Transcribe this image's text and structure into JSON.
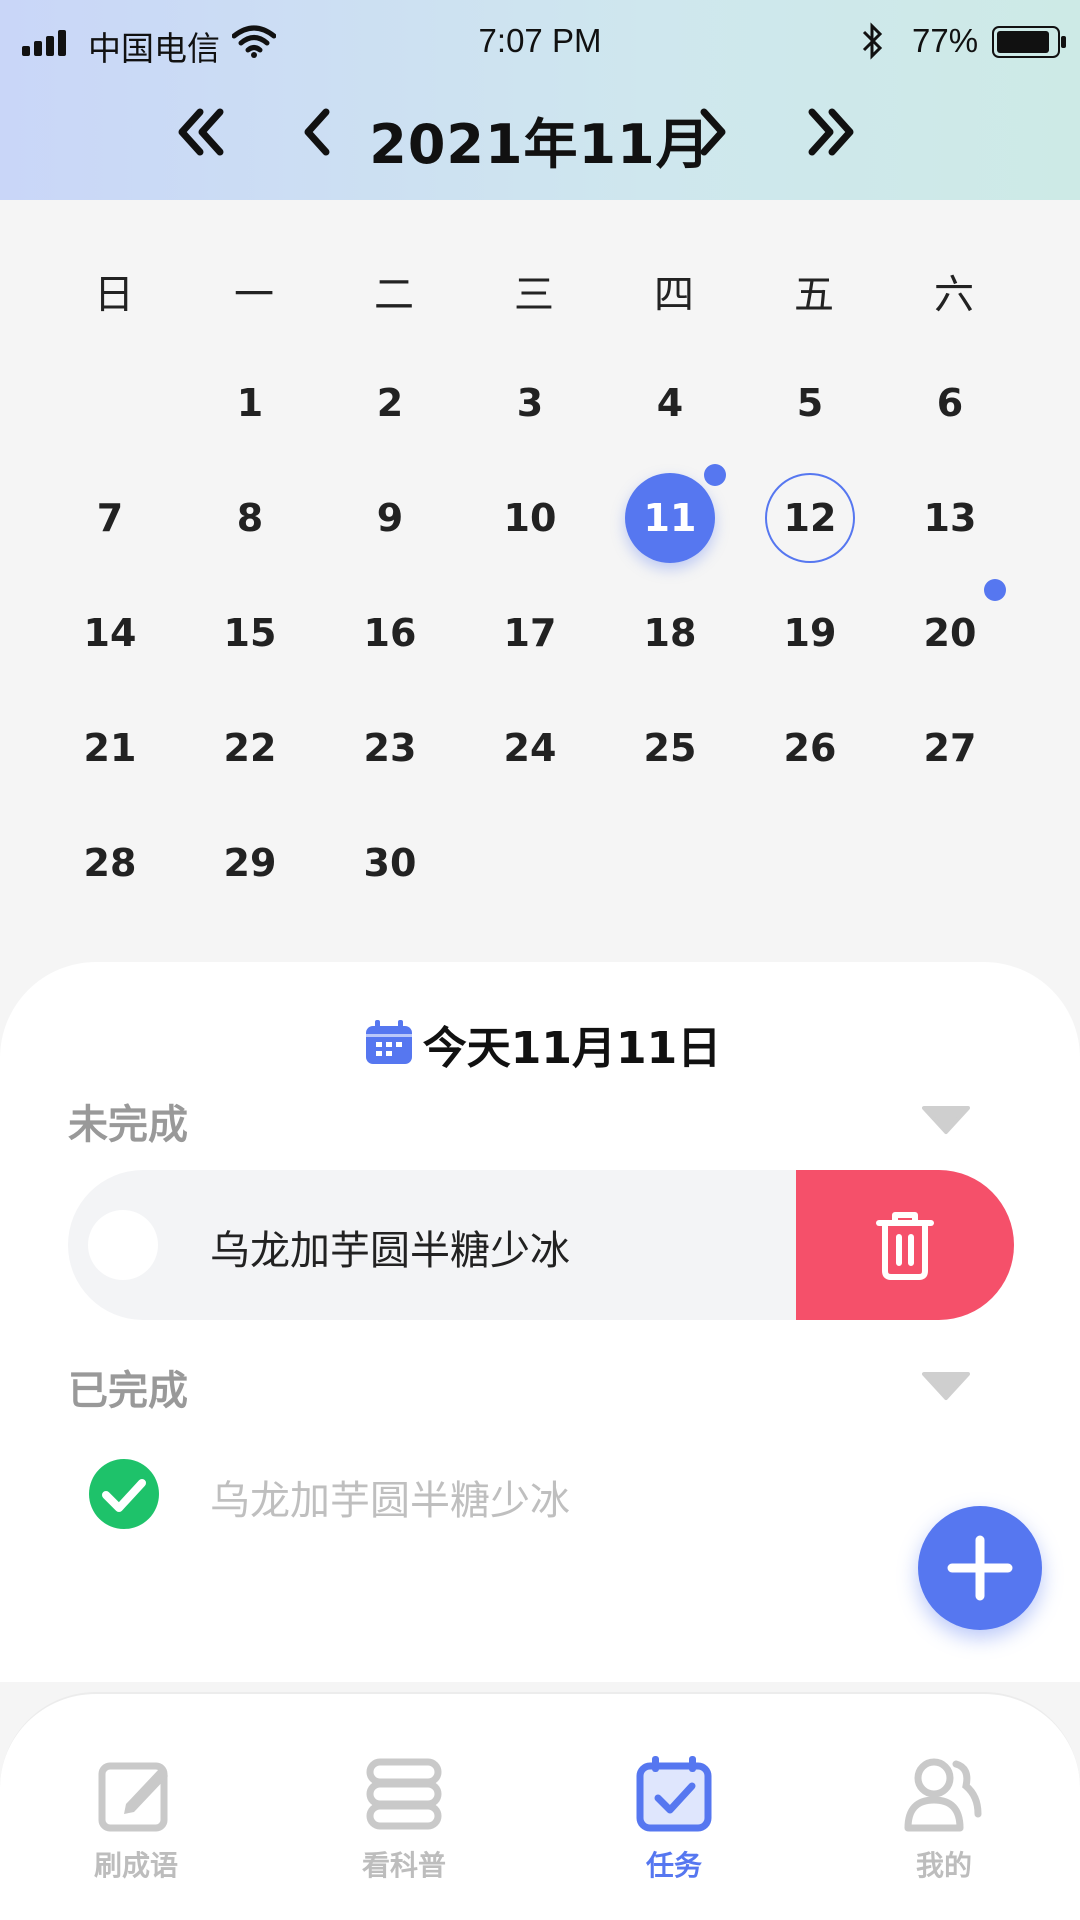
{
  "status_bar": {
    "carrier": "中国电信",
    "time": "7:07 PM",
    "battery": "77%"
  },
  "calendar": {
    "title": "2021年11月",
    "weekdays": [
      "日",
      "一",
      "二",
      "三",
      "四",
      "五",
      "六"
    ],
    "days": [
      "1",
      "2",
      "3",
      "4",
      "5",
      "6",
      "7",
      "8",
      "9",
      "10",
      "11",
      "12",
      "13",
      "14",
      "15",
      "16",
      "17",
      "18",
      "19",
      "20",
      "21",
      "22",
      "23",
      "24",
      "25",
      "26",
      "27",
      "28",
      "29",
      "30"
    ],
    "selected_day": "11",
    "today_day": "12",
    "days_with_tasks": [
      "11",
      "20"
    ],
    "accent_color": "#5677f0"
  },
  "tasks": {
    "header": "今天11月11日",
    "pending_label": "未完成",
    "pending": [
      {
        "text": "乌龙加芋圆半糖少冰"
      }
    ],
    "completed_label": "已完成",
    "completed": [
      {
        "text": "乌龙加芋圆半糖少冰"
      }
    ],
    "delete_color": "#f5506a",
    "done_color": "#1ec26a"
  },
  "tabbar": {
    "items": [
      {
        "label": "刷成语",
        "icon": "edit-icon",
        "active": false
      },
      {
        "label": "看科普",
        "icon": "books-icon",
        "active": false
      },
      {
        "label": "任务",
        "icon": "calendar-check-icon",
        "active": true
      },
      {
        "label": "我的",
        "icon": "users-icon",
        "active": false
      }
    ]
  }
}
